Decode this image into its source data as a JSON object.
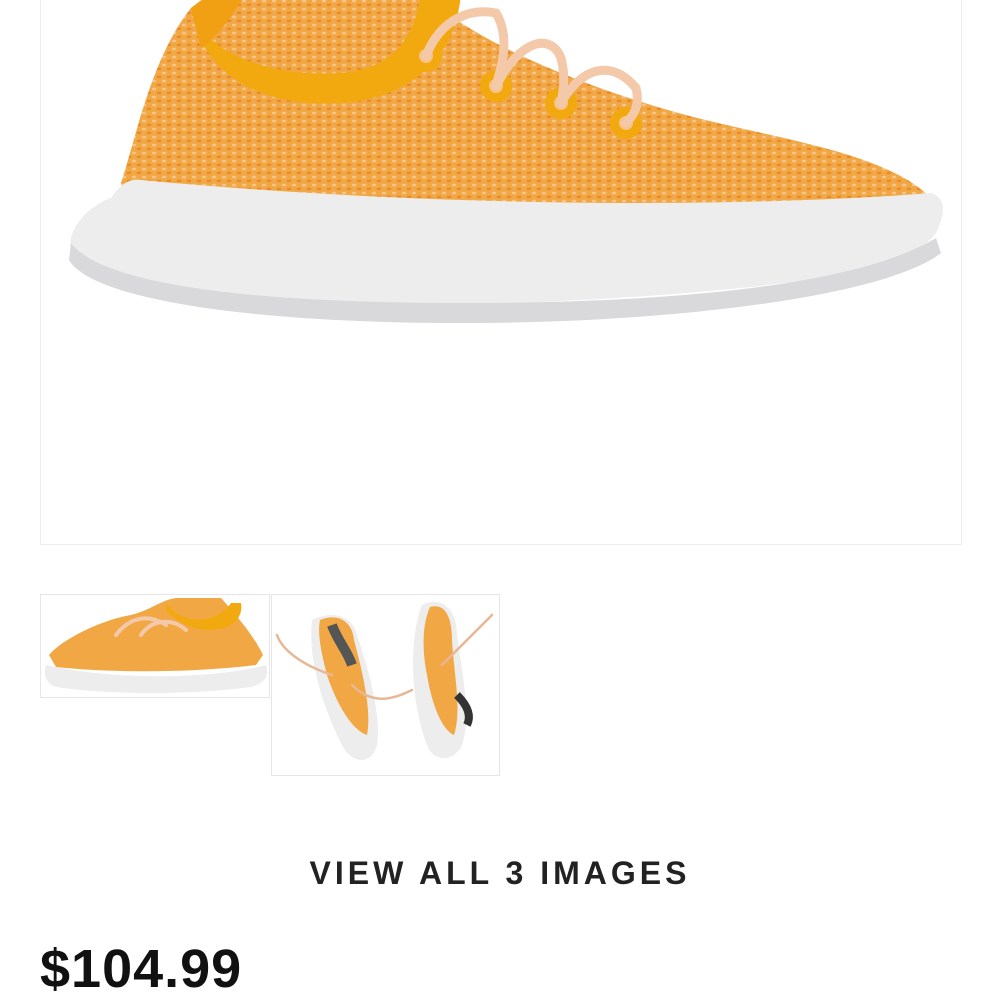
{
  "product": {
    "main_image_alt": "Orange knit sneaker, side view",
    "thumbnails": [
      {
        "alt": "Orange knit sneaker side view thumbnail"
      },
      {
        "alt": "Pair of orange knit sneakers with laces thumbnail"
      }
    ],
    "view_all_label": "VIEW ALL 3 IMAGES",
    "price": "$104.99"
  },
  "colors": {
    "upper": "#f0a43a",
    "collar": "#f2a90f",
    "sole": "#e9e9eb",
    "lace": "#f3c9a9"
  }
}
